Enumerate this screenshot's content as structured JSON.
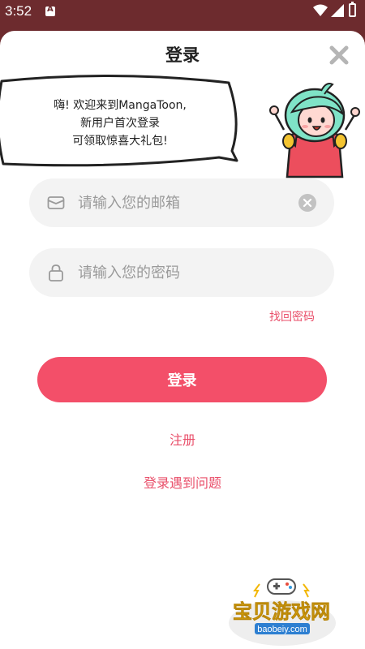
{
  "status_bar": {
    "time": "3:52"
  },
  "sheet": {
    "title": "登录",
    "close_icon": "close-icon"
  },
  "greeting": {
    "line1": "嗨! 欢迎来到MangaToon,",
    "line2": "新用户首次登录",
    "line3": "可领取惊喜大礼包!"
  },
  "form": {
    "email_placeholder": "请输入您的邮箱",
    "email_value": "",
    "password_placeholder": "请输入您的密码",
    "password_value": "",
    "forgot_password": "找回密码",
    "login_button": "登录",
    "register_link": "注册",
    "trouble_link": "登录遇到问题"
  },
  "watermark": {
    "brand": "宝贝游戏网",
    "url": "baobeiy.com"
  },
  "colors": {
    "accent": "#f34f69",
    "link": "#e94f6a",
    "status_bar_bg": "#6d2b2e",
    "field_bg": "#f3f3f3"
  }
}
